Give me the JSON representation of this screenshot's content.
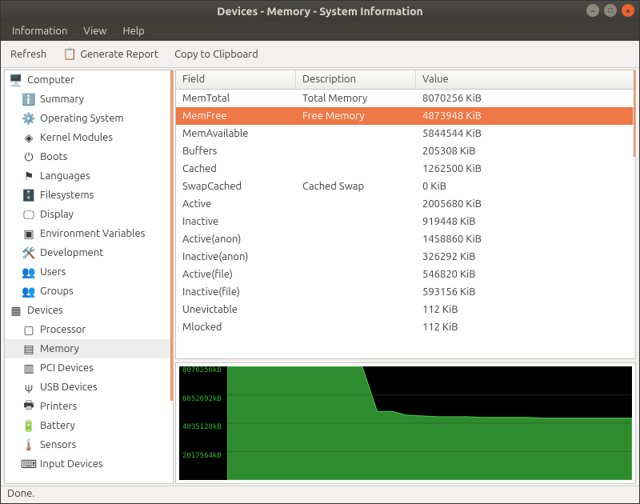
{
  "window": {
    "title": "Devices - Memory - System Information"
  },
  "menubar": {
    "items": [
      "Information",
      "View",
      "Help"
    ]
  },
  "toolbar": {
    "refresh": "Refresh",
    "report": "Generate Report",
    "clipboard": "Copy to Clipboard"
  },
  "sidebar": {
    "groups": [
      {
        "label": "Computer",
        "icon": "computer-icon",
        "glyph": "🖥️",
        "children": [
          {
            "label": "Summary",
            "icon": "info-icon",
            "glyph": "ℹ️"
          },
          {
            "label": "Operating System",
            "icon": "gear-icon",
            "glyph": "⚙️"
          },
          {
            "label": "Kernel Modules",
            "icon": "module-icon",
            "glyph": "◈"
          },
          {
            "label": "Boots",
            "icon": "power-icon",
            "glyph": "⏻"
          },
          {
            "label": "Languages",
            "icon": "flag-icon",
            "glyph": "⚑"
          },
          {
            "label": "Filesystems",
            "icon": "disk-icon",
            "glyph": "🗄️"
          },
          {
            "label": "Display",
            "icon": "display-icon",
            "glyph": "🖵"
          },
          {
            "label": "Environment Variables",
            "icon": "terminal-icon",
            "glyph": "▣"
          },
          {
            "label": "Development",
            "icon": "dev-icon",
            "glyph": "🛠️"
          },
          {
            "label": "Users",
            "icon": "users-icon",
            "glyph": "👥"
          },
          {
            "label": "Groups",
            "icon": "groups-icon",
            "glyph": "👥"
          }
        ]
      },
      {
        "label": "Devices",
        "icon": "chip-icon",
        "glyph": "▦",
        "children": [
          {
            "label": "Processor",
            "icon": "cpu-icon",
            "glyph": "▢"
          },
          {
            "label": "Memory",
            "icon": "memory-icon",
            "glyph": "▤",
            "selected": true
          },
          {
            "label": "PCI Devices",
            "icon": "pci-icon",
            "glyph": "▥"
          },
          {
            "label": "USB Devices",
            "icon": "usb-icon",
            "glyph": "ψ"
          },
          {
            "label": "Printers",
            "icon": "printer-icon",
            "glyph": "🖶"
          },
          {
            "label": "Battery",
            "icon": "battery-icon",
            "glyph": "🔋"
          },
          {
            "label": "Sensors",
            "icon": "sensor-icon",
            "glyph": "🌡️"
          },
          {
            "label": "Input Devices",
            "icon": "input-icon",
            "glyph": "⌨"
          }
        ]
      }
    ]
  },
  "table": {
    "headers": {
      "field": "Field",
      "desc": "Description",
      "val": "Value"
    },
    "rows": [
      {
        "field": "MemTotal",
        "desc": "Total Memory",
        "val": "8070256 KiB"
      },
      {
        "field": "MemFree",
        "desc": "Free Memory",
        "val": "4873948 KiB",
        "selected": true
      },
      {
        "field": "MemAvailable",
        "desc": "",
        "val": "5844544 KiB"
      },
      {
        "field": "Buffers",
        "desc": "",
        "val": "205308 KiB"
      },
      {
        "field": "Cached",
        "desc": "",
        "val": "1262500 KiB"
      },
      {
        "field": "SwapCached",
        "desc": "Cached Swap",
        "val": "0 KiB"
      },
      {
        "field": "Active",
        "desc": "",
        "val": "2005680 KiB"
      },
      {
        "field": "Inactive",
        "desc": "",
        "val": "919448 KiB"
      },
      {
        "field": "Active(anon)",
        "desc": "",
        "val": "1458860 KiB"
      },
      {
        "field": "Inactive(anon)",
        "desc": "",
        "val": "326292 KiB"
      },
      {
        "field": "Active(file)",
        "desc": "",
        "val": "546820 KiB"
      },
      {
        "field": "Inactive(file)",
        "desc": "",
        "val": "593156 KiB"
      },
      {
        "field": "Unevictable",
        "desc": "",
        "val": "112 KiB"
      },
      {
        "field": "Mlocked",
        "desc": "",
        "val": "112 KiB"
      }
    ]
  },
  "chart_data": {
    "type": "area",
    "title": "",
    "ylabel": "",
    "xlabel": "",
    "ylim": [
      0,
      8070256
    ],
    "y_ticks": [
      {
        "label": "8070256kB",
        "frac": 0.0
      },
      {
        "label": "6052692kB",
        "frac": 0.25
      },
      {
        "label": "4035128kB",
        "frac": 0.5
      },
      {
        "label": "2017564kB",
        "frac": 0.75
      }
    ],
    "series": [
      {
        "name": "used_memory_kb",
        "color": "#2e8b2e",
        "values": [
          8070256,
          8070256,
          8070256,
          8070256,
          8070256,
          8070256,
          8070256,
          8070256,
          8070256,
          8070256,
          4873948,
          4873948,
          4600000,
          4550000,
          4500000,
          4500000,
          4500000,
          4450000,
          4450000,
          4450000,
          4450000,
          4400000,
          4400000,
          4400000,
          4400000,
          4400000,
          4400000,
          4400000
        ]
      }
    ]
  },
  "status": {
    "text": "Done."
  }
}
